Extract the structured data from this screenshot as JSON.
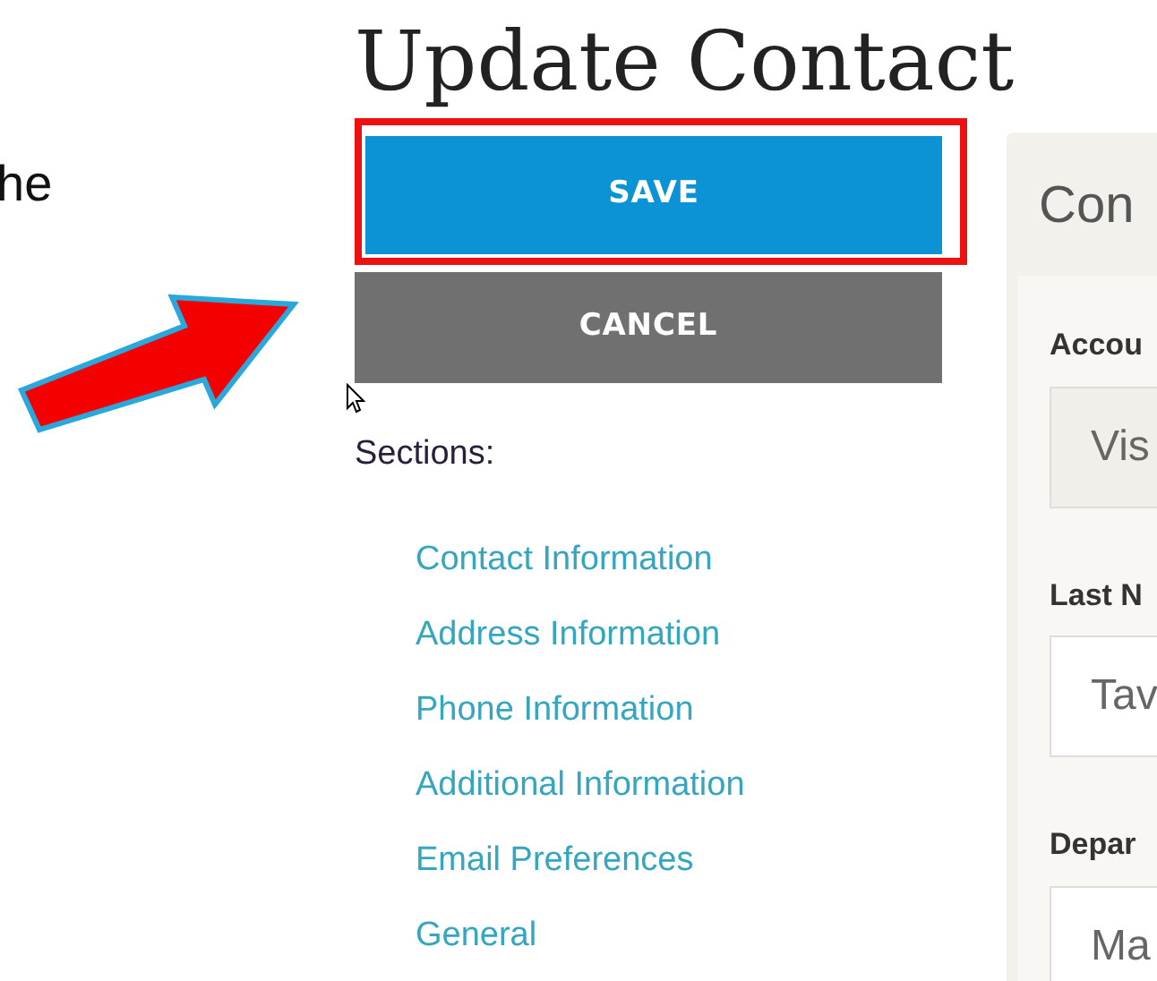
{
  "intro_text": "he",
  "title": "Update Contact",
  "buttons": [
    {
      "label": "SAVE",
      "kind": "primary",
      "highlighted": true
    },
    {
      "label": "CANCEL",
      "kind": "secondary",
      "highlighted": false
    }
  ],
  "sections": {
    "label": "Sections:",
    "links": [
      "Contact Information",
      "Address Information",
      "Phone Information",
      "Additional Information",
      "Email Preferences",
      "General"
    ]
  },
  "panel": {
    "title": "Con",
    "fields": [
      {
        "label": "Accou",
        "value": "Vis",
        "disabled": true
      },
      {
        "label": "Last N",
        "value": "Tav",
        "disabled": false
      },
      {
        "label": "Depar",
        "value": "Ma",
        "disabled": false
      }
    ]
  }
}
